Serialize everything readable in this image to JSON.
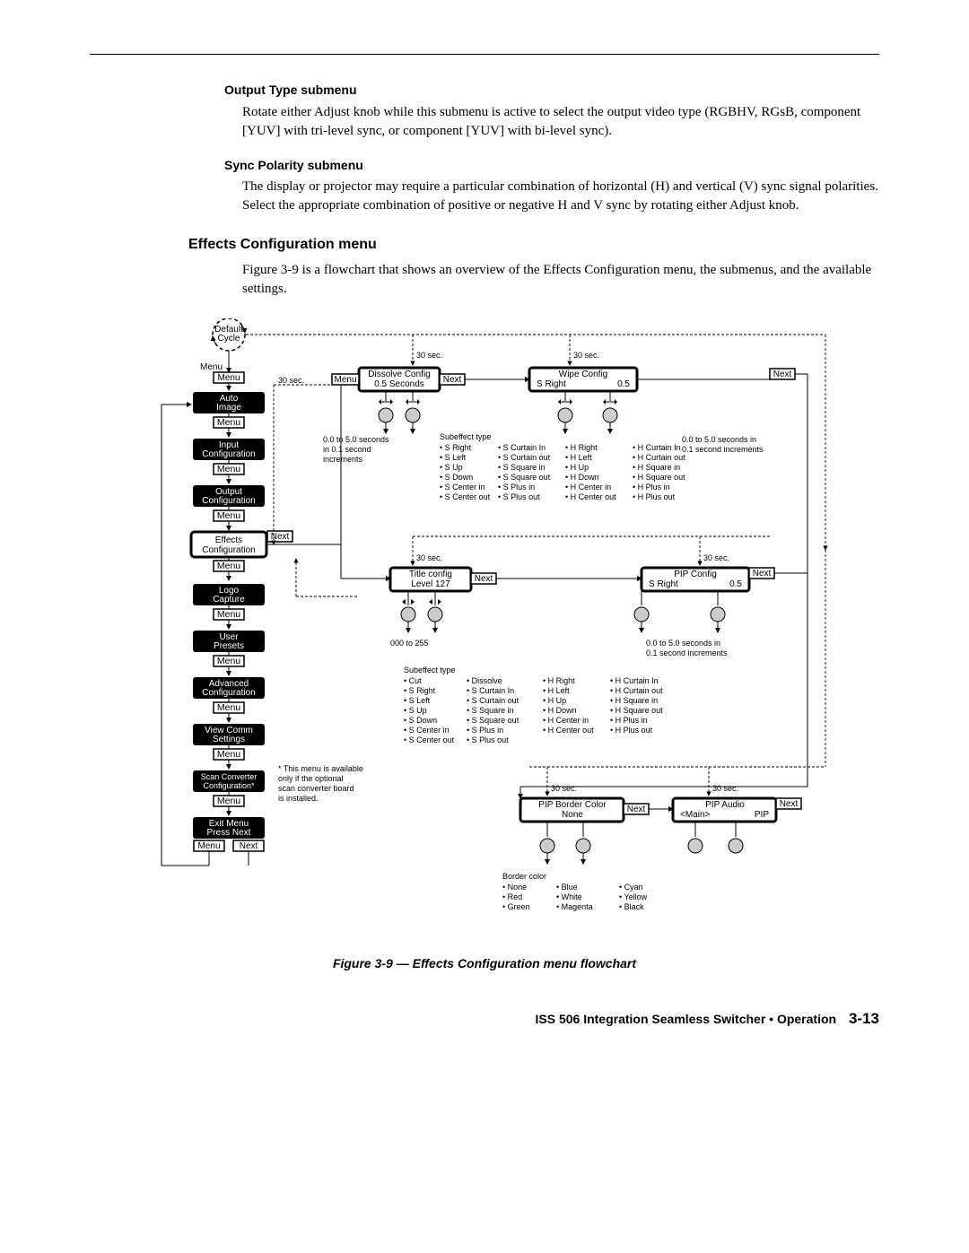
{
  "subhead1": "Output Type submenu",
  "para1": "Rotate either Adjust knob while this submenu is active to select the output video type (RGBHV, RGsB, component [YUV] with tri-level sync, or component [YUV] with bi-level sync).",
  "subhead2": "Sync Polarity submenu",
  "para2": "The display or projector may require a particular combination of horizontal (H) and vertical (V) sync signal polarities.  Select the appropriate combination of positive or negative H and V sync by rotating either Adjust knob.",
  "section": "Effects Configuration menu",
  "para3": "Figure 3-9 is a flowchart that shows an overview of the Effects Configuration menu, the submenus, and the available settings.",
  "flow": {
    "default_cycle": "Default\nCycle",
    "menu_label": "Menu",
    "next_label": "Next",
    "sec30": "30 sec.",
    "nodes": {
      "auto_image": "Auto\nImage",
      "input_config": "Input\nConfiguration",
      "output_config": "Output\nConfiguration",
      "effects_config": "Effects\nConfiguration",
      "logo_capture": "Logo\nCapture",
      "user_presets": "User\nPresets",
      "advanced_config": "Advanced\nConfiguration",
      "view_comm": "View Comm\nSettings",
      "scan_conv": "Scan Converter\nConfiguration*",
      "exit_menu": "Exit Menu\nPress Next"
    },
    "dissolve": {
      "line1": "Dissolve Config",
      "line2": "0.5 Seconds"
    },
    "wipe": {
      "line1": "Wipe Config",
      "line2": "S Right            0.5"
    },
    "dissolve_range": "0.0 to 5.0 seconds\nin 0.1 second\nincrements",
    "wipe_range": "0.0 to 5.0 seconds in\n0.1 second increments",
    "sub_head": "Subeffect type",
    "wipe_sub": [
      "• S Right",
      "• S Left",
      "• S Up",
      "• S Down",
      "• S Center in",
      "• S Center out",
      "• S Curtain In",
      "• S Curtain out",
      "• S Square in",
      "• S Square out",
      "• S Plus in",
      "• S Plus out",
      "• H Right",
      "• H Left",
      "• H Up",
      "• H Down",
      "• H Center in",
      "• H Center out",
      "• H Curtain In",
      "• H Curtain out",
      "• H Square in",
      "• H Square out",
      "• H Plus in",
      "• H Plus out"
    ],
    "title_config": {
      "line1": "Title config",
      "line2": "Level 127"
    },
    "pip_config": {
      "line1": "PIP Config",
      "line2": "S Right            0.5"
    },
    "title_range": "000 to 255",
    "pip_range": "0.0 to 5.0 seconds in\n0.1 second increments",
    "pip_sub_head": "Subeffect type",
    "pip_sub": [
      "• Cut",
      "• S Right",
      "• S Left",
      "• S Up",
      "• S Down",
      "• S Center in",
      "• S Center out",
      "• Dissolve",
      "• S Curtain In",
      "• S Curtain out",
      "• S Square in",
      "• S Square out",
      "• S Plus in",
      "• S Plus out",
      "• H Right",
      "• H Left",
      "• H Up",
      "• H Down",
      "• H Center in",
      "• H Center out",
      "• H Curtain In",
      "• H Curtain out",
      "• H Square in",
      "• H Square out",
      "• H Plus in",
      "• H Plus out"
    ],
    "pip_border": {
      "line1": "PIP Border Color",
      "line2": "None"
    },
    "pip_audio": {
      "line1": "PIP Audio",
      "line2": "<Main>          PIP"
    },
    "border_head": "Border color",
    "border_colors": [
      "• None",
      "• Red",
      "• Green",
      "• Blue",
      "• White",
      "• Magenta",
      "• Cyan",
      "• Yellow",
      "• Black"
    ],
    "scan_note": "* This menu is available\nonly if the optional\nscan converter board\nis installed."
  },
  "caption": "Figure 3-9 — Effects Configuration menu flowchart",
  "footer_text": "ISS 506 Integration Seamless Switcher • Operation",
  "footer_page": "3-13"
}
